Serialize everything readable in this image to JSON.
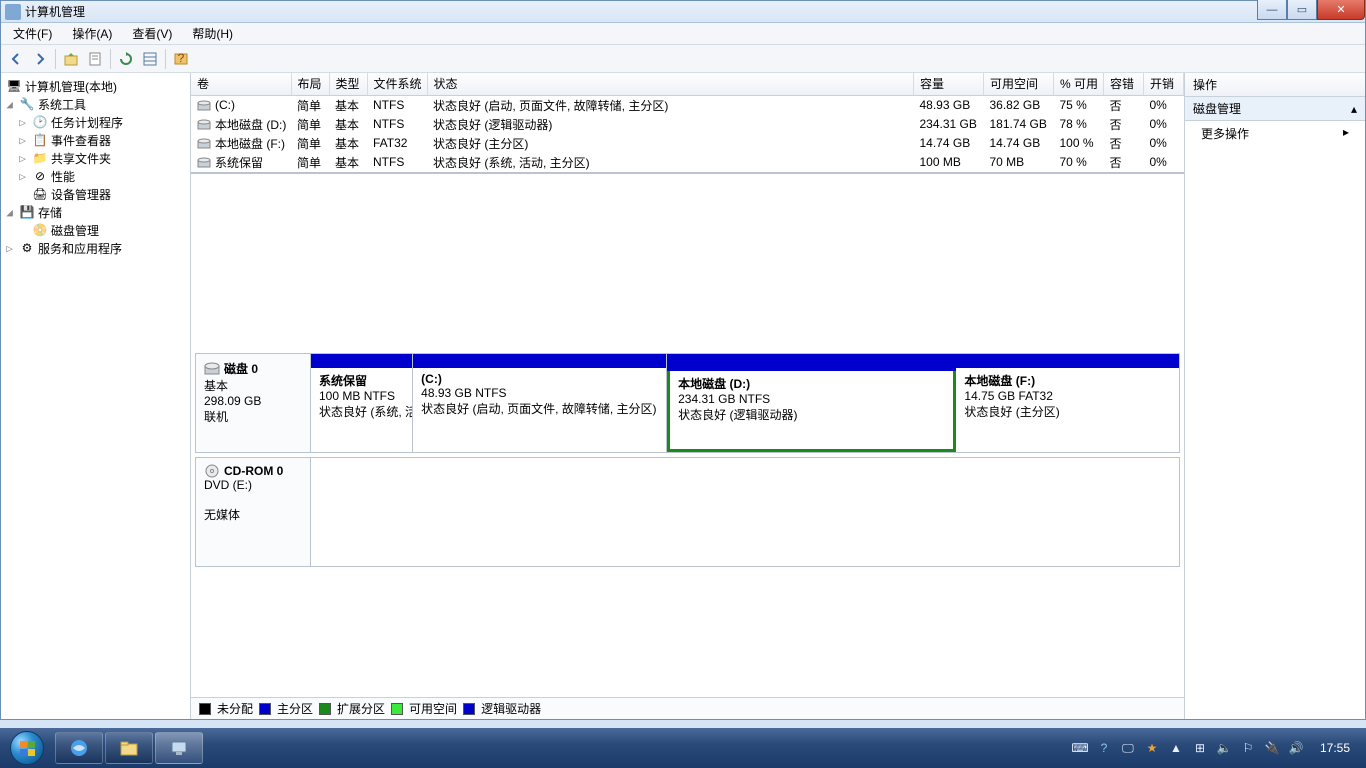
{
  "window": {
    "title": "计算机管理"
  },
  "menu": {
    "file": "文件(F)",
    "action": "操作(A)",
    "view": "查看(V)",
    "help": "帮助(H)"
  },
  "tree": {
    "root": "计算机管理(本地)",
    "systools": "系统工具",
    "sched": "任务计划程序",
    "eventv": "事件查看器",
    "shared": "共享文件夹",
    "perf": "性能",
    "devmgr": "设备管理器",
    "storage": "存储",
    "diskmgmt": "磁盘管理",
    "services": "服务和应用程序"
  },
  "gridHeaders": {
    "vol": "卷",
    "layout": "布局",
    "type": "类型",
    "fs": "文件系统",
    "status": "状态",
    "capacity": "容量",
    "free": "可用空间",
    "pctfree": "% 可用",
    "fault": "容错",
    "overhead": "开销"
  },
  "volumes": [
    {
      "name": "(C:)",
      "layout": "简单",
      "type": "基本",
      "fs": "NTFS",
      "status": "状态良好 (启动, 页面文件, 故障转储, 主分区)",
      "cap": "48.93 GB",
      "free": "36.82 GB",
      "pct": "75 %",
      "fault": "否",
      "oh": "0%"
    },
    {
      "name": "本地磁盘 (D:)",
      "layout": "简单",
      "type": "基本",
      "fs": "NTFS",
      "status": "状态良好 (逻辑驱动器)",
      "cap": "234.31 GB",
      "free": "181.74 GB",
      "pct": "78 %",
      "fault": "否",
      "oh": "0%"
    },
    {
      "name": "本地磁盘 (F:)",
      "layout": "简单",
      "type": "基本",
      "fs": "FAT32",
      "status": "状态良好 (主分区)",
      "cap": "14.74 GB",
      "free": "14.74 GB",
      "pct": "100 %",
      "fault": "否",
      "oh": "0%"
    },
    {
      "name": "系统保留",
      "layout": "简单",
      "type": "基本",
      "fs": "NTFS",
      "status": "状态良好 (系统, 活动, 主分区)",
      "cap": "100 MB",
      "free": "70 MB",
      "pct": "70 %",
      "fault": "否",
      "oh": "0%"
    }
  ],
  "disk0": {
    "label": "磁盘 0",
    "type": "基本",
    "size": "298.09 GB",
    "state": "联机",
    "parts": [
      {
        "title": "系统保留",
        "line2": "100 MB NTFS",
        "line3": "状态良好 (系统, 活动, 主分区)",
        "flex": "100",
        "selected": false
      },
      {
        "title": "(C:)",
        "line2": "48.93 GB NTFS",
        "line3": "状态良好 (启动, 页面文件, 故障转储, 主分区)",
        "flex": "250",
        "selected": false
      },
      {
        "title": "本地磁盘  (D:)",
        "line2": "234.31 GB NTFS",
        "line3": "状态良好 (逻辑驱动器)",
        "flex": "280",
        "selected": true
      },
      {
        "title": "本地磁盘  (F:)",
        "line2": "14.75 GB FAT32",
        "line3": "状态良好 (主分区)",
        "flex": "220",
        "selected": false
      }
    ]
  },
  "cdrom": {
    "label": "CD-ROM 0",
    "line2": "DVD (E:)",
    "line3": "无媒体"
  },
  "legend": {
    "unalloc": "未分配",
    "primary": "主分区",
    "extended": "扩展分区",
    "free": "可用空间",
    "logical": "逻辑驱动器"
  },
  "actions": {
    "header": "操作",
    "section": "磁盘管理",
    "more": "更多操作"
  },
  "taskbar": {
    "clock": "17:55"
  }
}
